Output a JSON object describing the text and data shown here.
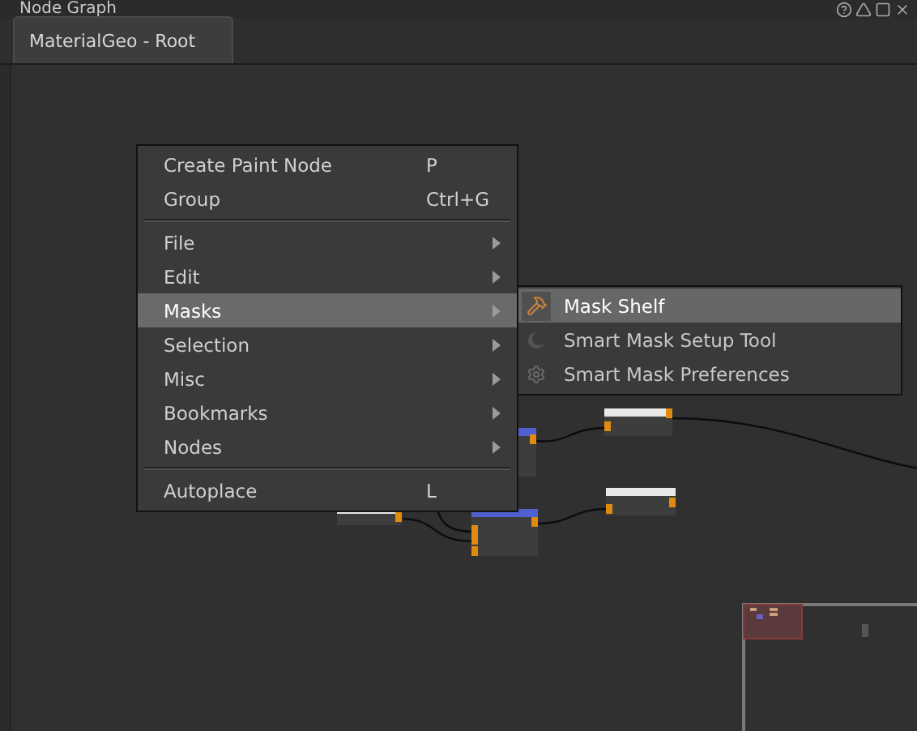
{
  "panel": {
    "title": "Node Graph"
  },
  "tabs": [
    {
      "label": "MaterialGeo - Root",
      "selected": true
    }
  ],
  "context_menu": {
    "items": [
      {
        "kind": "action",
        "label": "Create Paint Node",
        "shortcut": "P",
        "selected": false
      },
      {
        "kind": "action",
        "label": "Group",
        "shortcut": "Ctrl+G",
        "selected": false
      },
      {
        "kind": "separator"
      },
      {
        "kind": "submenu",
        "label": "File",
        "selected": false
      },
      {
        "kind": "submenu",
        "label": "Edit",
        "selected": false
      },
      {
        "kind": "submenu",
        "label": "Masks",
        "selected": true
      },
      {
        "kind": "submenu",
        "label": "Selection",
        "selected": false
      },
      {
        "kind": "submenu",
        "label": "Misc",
        "selected": false
      },
      {
        "kind": "submenu",
        "label": "Bookmarks",
        "selected": false
      },
      {
        "kind": "submenu",
        "label": "Nodes",
        "selected": false
      },
      {
        "kind": "separator"
      },
      {
        "kind": "action",
        "label": "Autoplace",
        "shortcut": "L",
        "selected": false
      }
    ]
  },
  "submenu": {
    "items": [
      {
        "label": "Mask Shelf",
        "selected": true
      },
      {
        "label": "Smart Mask Setup Tool",
        "selected": false
      },
      {
        "label": "Smart Mask Preferences",
        "selected": false
      }
    ]
  }
}
